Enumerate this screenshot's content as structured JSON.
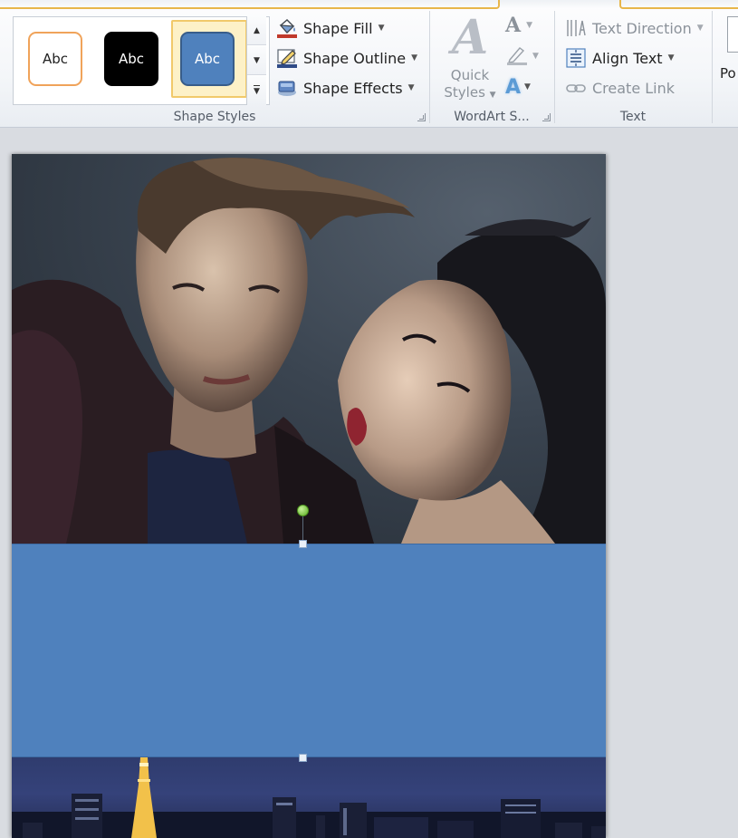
{
  "ribbon": {
    "shape_styles": {
      "group_label": "Shape Styles",
      "styles": [
        {
          "label": "Abc",
          "variant": "orange-outline"
        },
        {
          "label": "Abc",
          "variant": "black-fill"
        },
        {
          "label": "Abc",
          "variant": "blue-fill",
          "selected": true
        }
      ],
      "commands": {
        "fill": "Shape Fill",
        "outline": "Shape Outline",
        "effects": "Shape Effects"
      }
    },
    "wordart": {
      "group_label": "WordArt S...",
      "quick_styles_line1": "Quick",
      "quick_styles_line2": "Styles"
    },
    "text": {
      "group_label": "Text",
      "text_direction": "Text Direction",
      "align_text": "Align Text",
      "create_link": "Create Link"
    },
    "cut_off_label": "Po"
  },
  "colors": {
    "accent_blue": "#4f81bd",
    "selection_gold": "#f1c96a",
    "orange_outline": "#f0a35a",
    "rotate_handle_green": "#5cae22"
  }
}
